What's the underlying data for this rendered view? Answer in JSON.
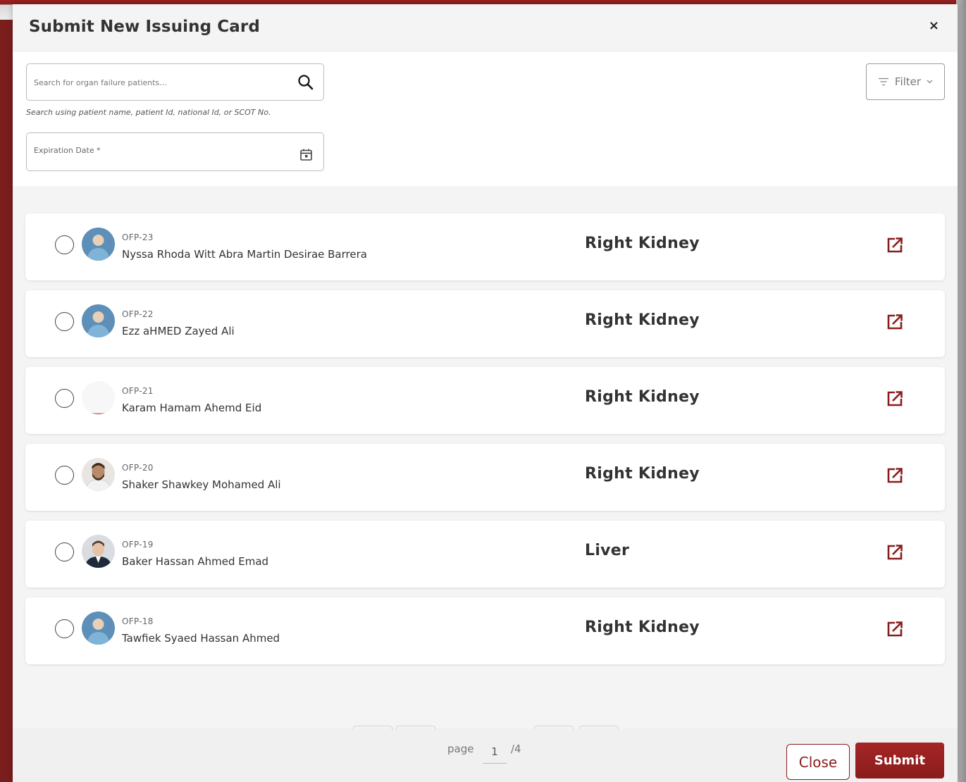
{
  "modal": {
    "title": "Submit New Issuing Card",
    "close_icon_glyph": "×"
  },
  "search": {
    "placeholder": "Search for organ failure patients...",
    "hint": "Search using patient name, patient Id, national Id, or SCOT No."
  },
  "expiration": {
    "label": "Expiration Date *"
  },
  "filter": {
    "label": "Filter"
  },
  "patients": [
    {
      "code": "OFP-23",
      "name": "Nyssa Rhoda Witt Abra Martin Desirae Barrera",
      "organ": "Right Kidney",
      "avatar": "default-avatar"
    },
    {
      "code": "OFP-22",
      "name": "Ezz aHMED Zayed Ali",
      "organ": "Right Kidney",
      "avatar": "default-avatar"
    },
    {
      "code": "OFP-21",
      "name": "Karam Hamam Ahemd Eid",
      "organ": "Right Kidney",
      "avatar": "blank-avatar"
    },
    {
      "code": "OFP-20",
      "name": "Shaker Shawkey Mohamed Ali",
      "organ": "Right Kidney",
      "avatar": "photo-avatar-bearded"
    },
    {
      "code": "OFP-19",
      "name": "Baker Hassan Ahmed Emad",
      "organ": "Liver",
      "avatar": "photo-avatar-suit"
    },
    {
      "code": "OFP-18",
      "name": "Tawfiek Syaed Hassan Ahmed",
      "organ": "Right Kidney",
      "avatar": "default-avatar"
    }
  ],
  "pagination": {
    "page_label": "page",
    "current_page": "1",
    "total": "/4"
  },
  "footer": {
    "close_label": "Close",
    "submit_label": "Submit"
  },
  "colors": {
    "brand": "#8b1c1c",
    "text": "#333333",
    "row_bg": "#ffffff",
    "panel_bg": "#f4f4f4"
  }
}
